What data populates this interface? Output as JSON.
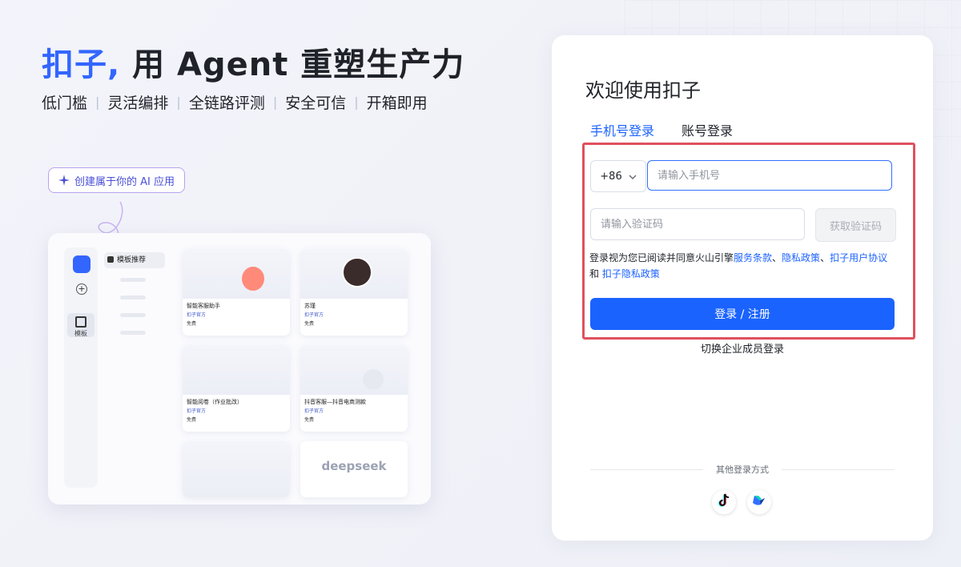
{
  "hero": {
    "brand": "扣子,",
    "title_rest": " 用 Agent 重塑生产力",
    "features": [
      "低门槛",
      "灵活编排",
      "全链路评测",
      "安全可信",
      "开箱即用"
    ],
    "pill_label": "创建属于你的 AI 应用"
  },
  "mock": {
    "template_label": "模板",
    "nav_label": "模板推荐",
    "cards": [
      {
        "title": "智能客服助手",
        "owner": "扣子官方",
        "footer": "免费"
      },
      {
        "title": "苏瑾",
        "owner": "扣子官方",
        "footer": "免费"
      },
      {
        "title": "智能阅卷（作业批改）",
        "owner": "扣子官方",
        "footer": "免费"
      },
      {
        "title": "抖音客服—抖音电商测款",
        "owner": "扣子官方",
        "footer": "免费"
      },
      {
        "title": "",
        "owner": "",
        "footer": ""
      },
      {
        "title": "deepseek",
        "owner": "",
        "footer": ""
      }
    ]
  },
  "login": {
    "welcome": "欢迎使用扣子",
    "tabs": [
      "手机号登录",
      "账号登录"
    ],
    "country_code": "+86",
    "phone_placeholder": "请输入手机号",
    "code_placeholder": "请输入验证码",
    "get_code": "获取验证码",
    "agree_prefix": "登录视为您已阅读并同意火山引擎",
    "link_terms": "服务条款",
    "sep1": "、",
    "link_privacy": "隐私政策",
    "sep2": "、",
    "link_user_agreement": "扣子用户协议",
    "and_text": "和",
    "link_coze_privacy": "扣子隐私政策",
    "submit": "登录 / 注册",
    "switch_enterprise": "切换企业成员登录",
    "other_methods": "其他登录方式",
    "sso": [
      "douyin-icon",
      "feishu-icon"
    ]
  },
  "colors": {
    "accent": "#1a63ff",
    "brand": "#3366ff",
    "highlight": "#e0505c"
  }
}
